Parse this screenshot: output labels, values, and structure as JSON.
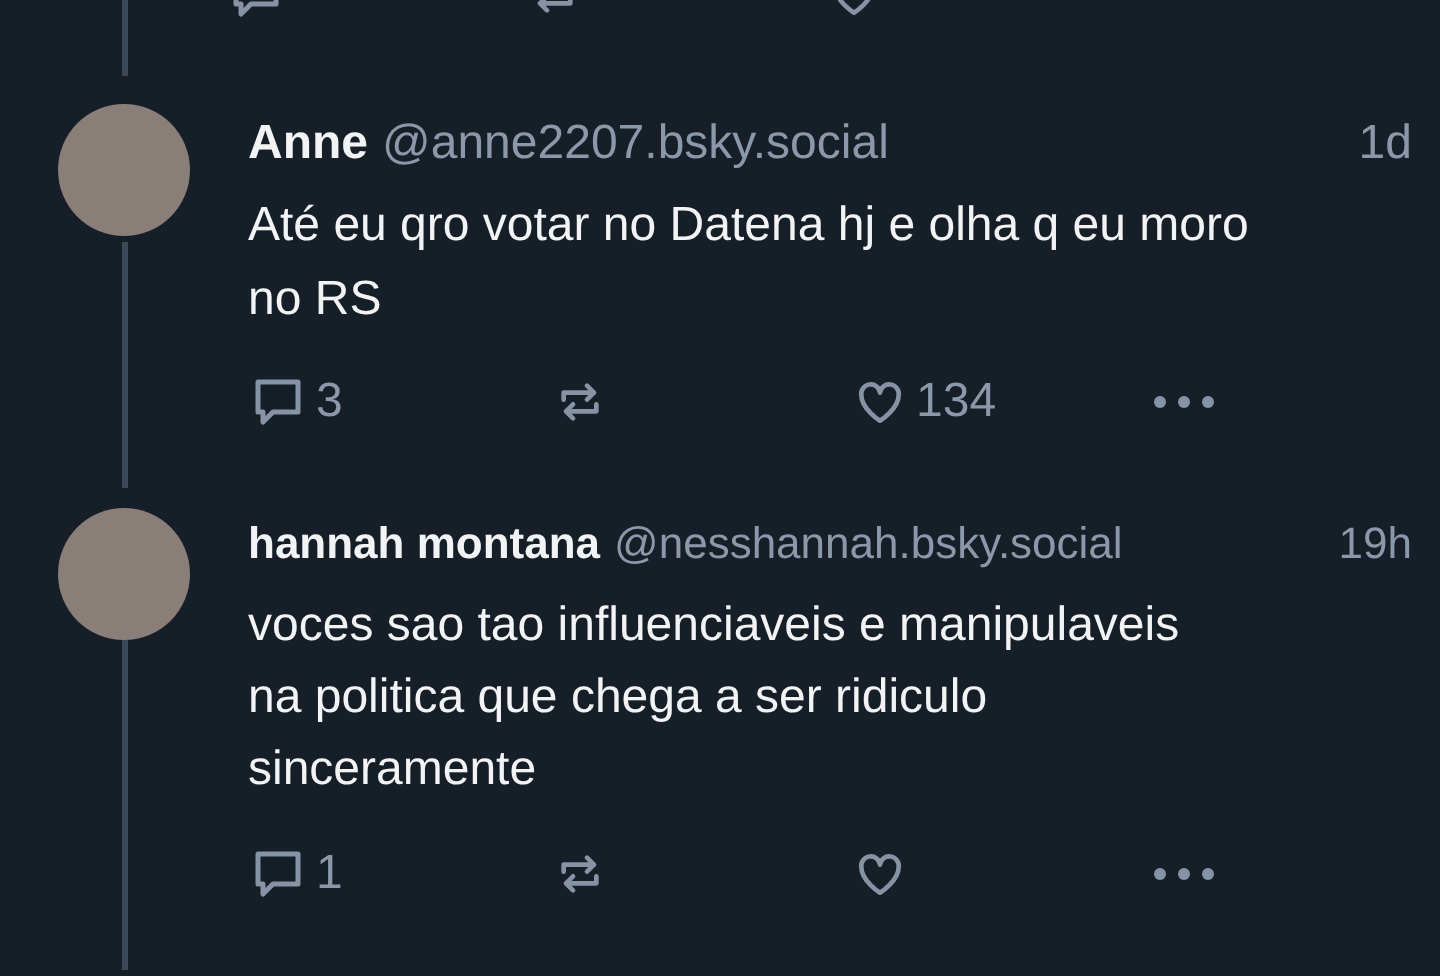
{
  "posts": [
    {
      "author": "Anne",
      "handle": "@anne2207.bsky.social",
      "time": "1d",
      "text_lines": [
        "Até eu qro votar no Datena hj e olha q eu moro",
        "no RS"
      ],
      "replies": "3",
      "likes": "134"
    },
    {
      "author": "hannah montana",
      "handle": "@nesshannah.bsky.social",
      "time": "19h",
      "text_lines": [
        "voces sao tao influenciaveis e manipulaveis",
        "na politica que chega a ser ridiculo",
        "sinceramente"
      ],
      "replies": "1"
    }
  ]
}
